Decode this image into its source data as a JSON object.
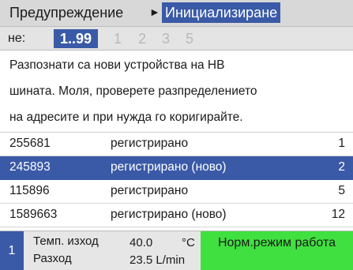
{
  "header": {
    "crumb": "Предупреждение",
    "arrow": "►",
    "active_crumb": "Инициализиране"
  },
  "pager": {
    "label": "не:",
    "current": "1..99",
    "pages": [
      "1",
      "2",
      "3",
      "5"
    ]
  },
  "message": {
    "lines": [
      "Разпознати са нови устройства на HВ",
      "шината. Моля, проверете разпределението",
      "на адресите и при нужда го коригирайте."
    ]
  },
  "devices": [
    {
      "id": "255681",
      "status": "регистрирано",
      "num": "1",
      "selected": false
    },
    {
      "id": "245893",
      "status": "регистрирано (ново)",
      "num": "2",
      "selected": true
    },
    {
      "id": "115896",
      "status": "регистрирано",
      "num": "5",
      "selected": false
    },
    {
      "id": "1589663",
      "status": "регистрирано (ново)",
      "num": "12",
      "selected": false
    }
  ],
  "statusbar": {
    "channel": "1",
    "temp_label": "Темп. изход",
    "temp_value": "40.0",
    "temp_unit": "°C",
    "flow_label": "Разход",
    "flow_value": "23.5 L/min",
    "mode": "Норм.режим работа"
  },
  "colors": {
    "accent": "#3a5aa7",
    "mode_ok": "#3fe03f"
  }
}
